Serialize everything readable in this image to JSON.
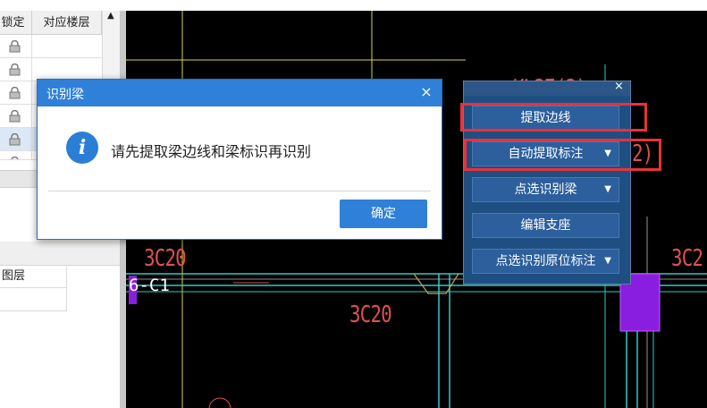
{
  "left_panel": {
    "columns": [
      "锁定",
      "对应楼层"
    ],
    "row_count": 6,
    "lower_row_label": "图层"
  },
  "cad": {
    "labels": [
      "KL27(2)",
      "3C20",
      "3C20",
      "3C2",
      "6-C1",
      "2)"
    ]
  },
  "dialog": {
    "title": "识别梁",
    "close": "×",
    "info_glyph": "i",
    "message": "请先提取梁边线和梁标识再识别",
    "ok": "确定"
  },
  "toolbar": {
    "close": "×",
    "dropdown_glyph": "▼",
    "buttons": [
      "提取边线",
      "自动提取标注",
      "点选识别梁",
      "编辑支座",
      "点选识别原位标注"
    ]
  },
  "colors": {
    "accent": "#2f80d8",
    "toolbar_bg": "#1f4f82",
    "highlight": "#e8323a",
    "cad_text": "#e05050",
    "cad_cyan": "#33c7c7",
    "cad_yellow": "#d8d838",
    "column_purple": "#8a1ee0"
  },
  "icons": [
    "lock-icon",
    "info-icon",
    "close-icon",
    "chevron-down-icon",
    "scroll-up-icon"
  ]
}
